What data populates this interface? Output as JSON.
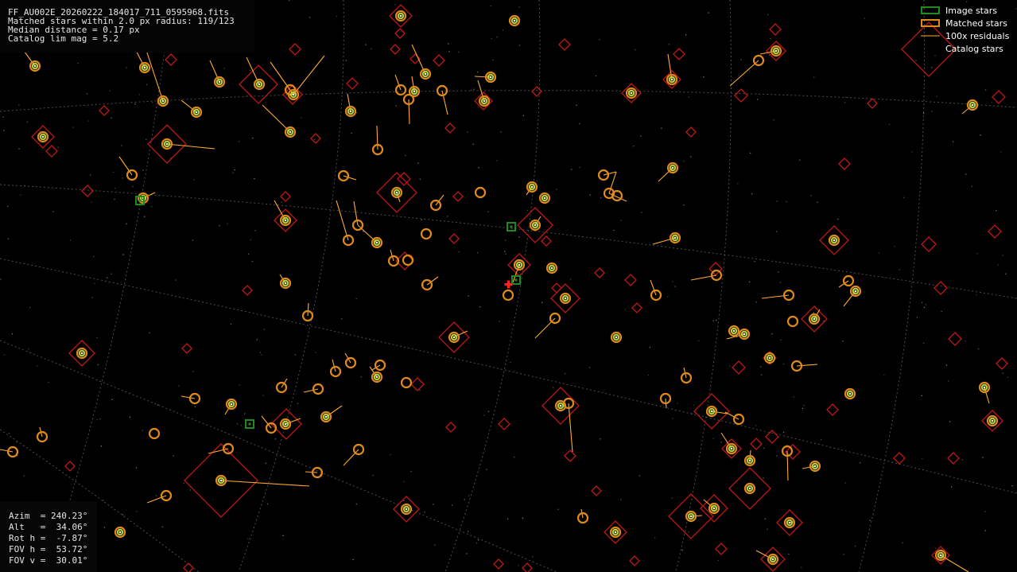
{
  "header": {
    "filename": "FF_AU002E_20260222_184017_711_0595968.fits",
    "matched_line": "Matched stars within 2.0 px radius: 119/123",
    "median_line": "Median distance = 0.17 px",
    "catalog_line": "Catalog lim mag = 5.2"
  },
  "legend": {
    "image_stars": "Image stars",
    "matched_stars": "Matched stars",
    "residuals": "100x residuals",
    "catalog_stars": "Catalog stars"
  },
  "pointing": {
    "azim": "Azim  = 240.23°",
    "alt": "Alt   =  34.06°",
    "rot": "Rot h =  -7.87°",
    "fov_h": "FOV h =  53.72°",
    "fov_v": "FOV v =  30.01°"
  },
  "colors": {
    "background": "#000000",
    "grid": "#8a8a8a",
    "image_star": "#1f8a1f",
    "matched_star": "#e08a1a",
    "image_core": "#b8d640",
    "residual": "#ffaa33",
    "catalog_star": "#c01818",
    "center_marker": "#ff2020"
  }
}
